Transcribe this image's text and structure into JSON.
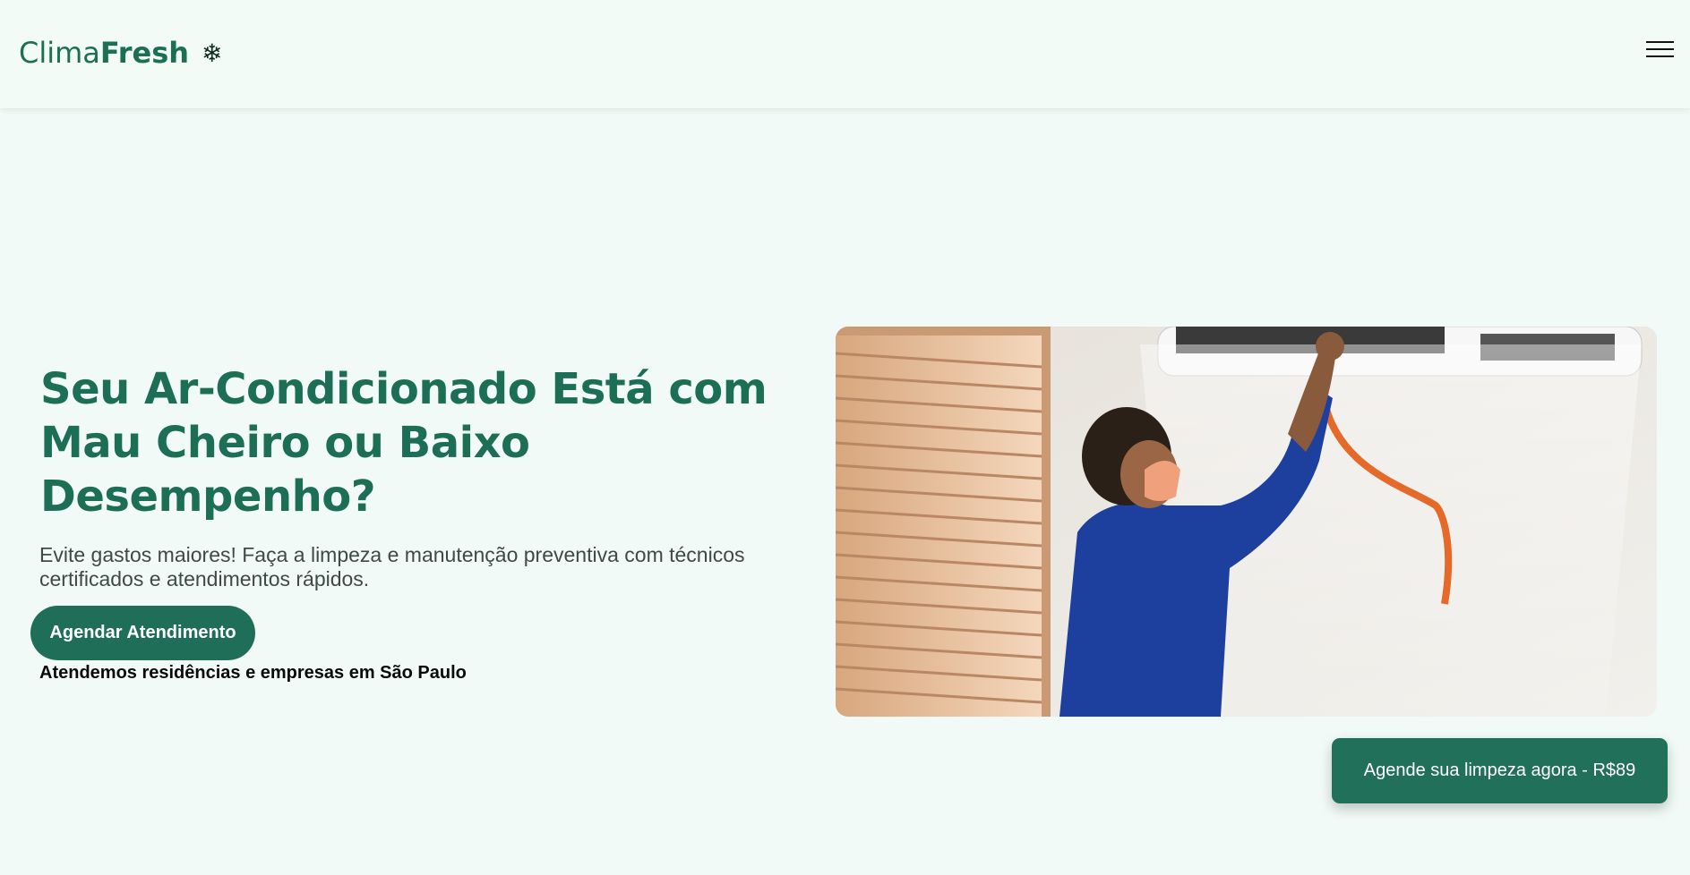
{
  "header": {
    "logo_light": "Clima",
    "logo_bold": "Fresh",
    "logo_icon": "snowflake-icon",
    "menu_icon": "hamburger-menu-icon"
  },
  "hero": {
    "title": "Seu Ar-Condicionado Está com Mau Cheiro ou Baixo Desempenho?",
    "subtitle": "Evite gastos maiores! Faça a limpeza e manutenção preventiva com técnicos certificados e atendimentos rápidos.",
    "cta_label": "Agendar Atendimento",
    "note": "Atendemos residências e empresas em São Paulo"
  },
  "floating_cta": {
    "label": "Agende sua limpeza agora - R$89"
  },
  "colors": {
    "brand": "#1c6e55",
    "background": "#f1faf6",
    "technician_shirt": "#1d3f9e"
  }
}
